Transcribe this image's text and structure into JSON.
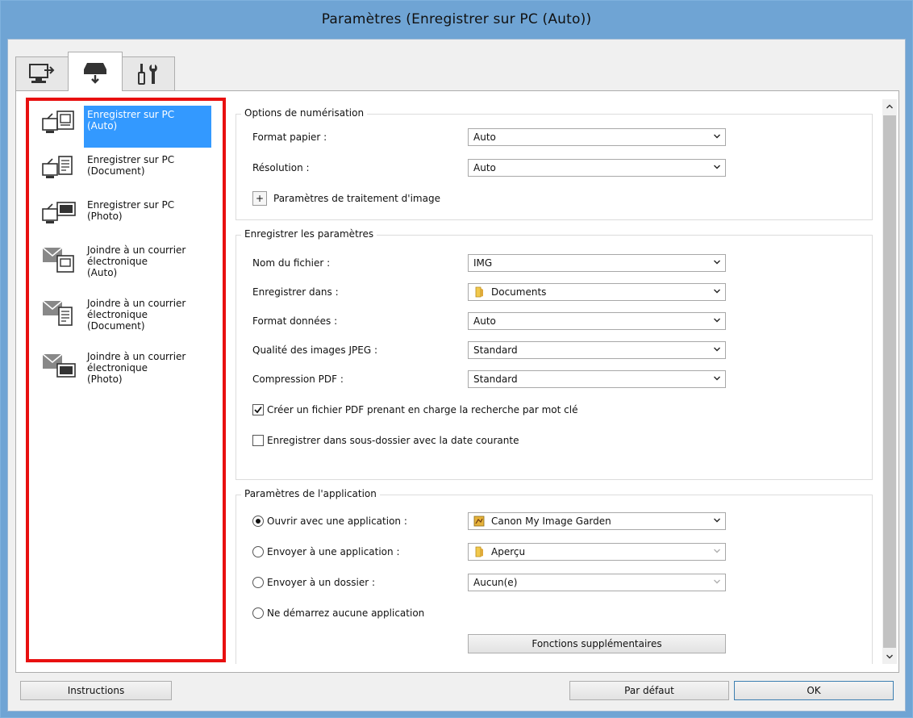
{
  "window": {
    "title": "Paramètres (Enregistrer sur PC (Auto))"
  },
  "colors": {
    "accent": "#3399ff",
    "highlight_border": "#e81010",
    "titlebar": "#6fa4d4"
  },
  "tabs": [
    {
      "icon": "scan-to-pc-icon",
      "active": false
    },
    {
      "icon": "scanner-icon",
      "active": true
    },
    {
      "icon": "tools-icon",
      "active": false
    }
  ],
  "left_list": {
    "items": [
      {
        "label": "Enregistrer sur PC\n(Auto)",
        "icon": "save-auto-icon",
        "selected": true
      },
      {
        "label": "Enregistrer sur PC\n(Document)",
        "icon": "save-document-icon",
        "selected": false
      },
      {
        "label": "Enregistrer sur PC\n(Photo)",
        "icon": "save-photo-icon",
        "selected": false
      },
      {
        "label": "Joindre à un courrier\nélectronique\n(Auto)",
        "icon": "mail-auto-icon",
        "selected": false
      },
      {
        "label": "Joindre à un courrier\nélectronique\n(Document)",
        "icon": "mail-document-icon",
        "selected": false
      },
      {
        "label": "Joindre à un courrier\nélectronique\n(Photo)",
        "icon": "mail-photo-icon",
        "selected": false
      }
    ]
  },
  "scan_options": {
    "title": "Options de numérisation",
    "paper_size_label": "Format papier :",
    "paper_size_value": "Auto",
    "resolution_label": "Résolution :",
    "resolution_value": "Auto",
    "image_processing_label": "Paramètres de traitement d'image",
    "expand_symbol": "+"
  },
  "save_settings": {
    "title": "Enregistrer les paramètres",
    "file_name_label": "Nom du fichier :",
    "file_name_value": "IMG",
    "save_in_label": "Enregistrer dans :",
    "save_in_value": "Documents",
    "data_format_label": "Format données :",
    "data_format_value": "Auto",
    "jpeg_quality_label": "Qualité des images JPEG :",
    "jpeg_quality_value": "Standard",
    "pdf_compression_label": "Compression PDF :",
    "pdf_compression_value": "Standard",
    "keyword_pdf_label": "Créer un fichier PDF prenant en charge la recherche par mot clé",
    "keyword_pdf_checked": true,
    "subfolder_label": "Enregistrer dans sous-dossier avec la date courante",
    "subfolder_checked": false
  },
  "app_settings": {
    "title": "Paramètres de l'application",
    "open_app_label": "Ouvrir avec une application :",
    "open_app_value": "Canon My Image Garden",
    "send_app_label": "Envoyer à une application :",
    "send_app_value": "Aperçu",
    "send_folder_label": "Envoyer à un dossier :",
    "send_folder_value": "Aucun(e)",
    "no_app_label": "Ne démarrez aucune application",
    "selected_option": "open_app",
    "more_functions_label": "Fonctions supplémentaires"
  },
  "footer": {
    "instructions_label": "Instructions",
    "defaults_label": "Par défaut",
    "ok_label": "OK"
  }
}
